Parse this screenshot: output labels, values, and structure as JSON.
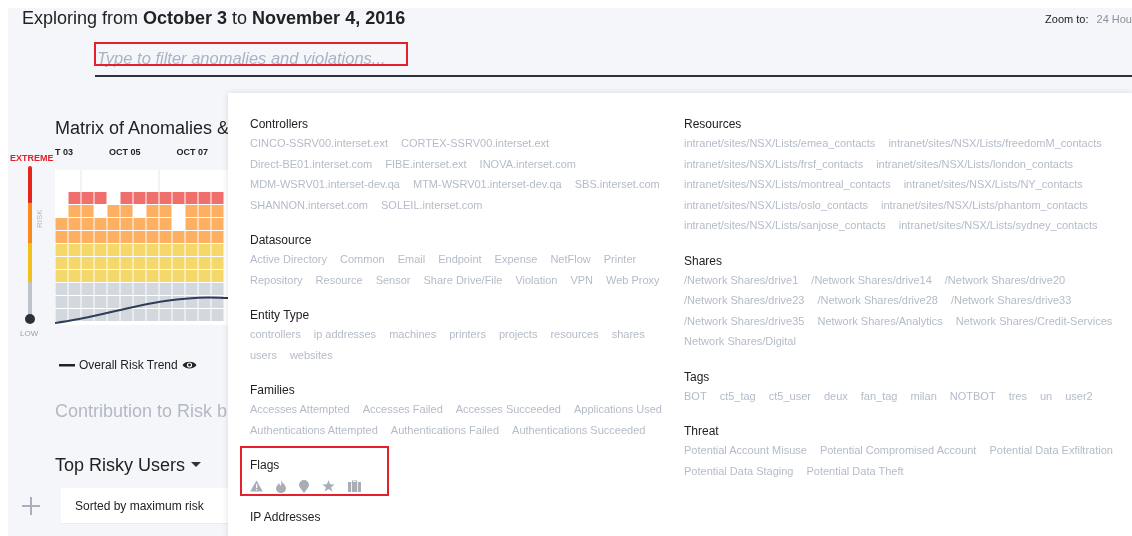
{
  "header": {
    "title": "Exploring from **October 3** to **November 4, 2016**",
    "zoom_label": "Zoom to:",
    "zoom_value": "24 Hou"
  },
  "filter": {
    "placeholder": "Type to filter anomalies and violations...",
    "highlighted": true
  },
  "matrix": {
    "title": "Matrix of Anomalies &",
    "x_labels": [
      "T 03",
      "OCT 05",
      "OCT 07"
    ],
    "scale_top": "EXTREME",
    "scale_axis": "RISK",
    "scale_bottom": "LOW",
    "legend": "Overall Risk Trend"
  },
  "contribution": {
    "title": "Contribution to Risk b"
  },
  "top_users": {
    "title": "Top Risky Users",
    "sort_label": "Sorted by maximum risk"
  },
  "dropdown": {
    "columns": [
      [
        {
          "kind": "text",
          "heading": "Controllers",
          "items": [
            "CINCO-SSRV00.interset.ext",
            "CORTEX-SSRV00.interset.ext",
            "Direct-BE01.interset.com",
            "FIBE.interset.ext",
            "INOVA.interset.com",
            "MDM-WSRV01.interset-dev.qa",
            "MTM-WSRV01.interset-dev.qa",
            "SBS.interset.com",
            "SHANNON.interset.com",
            "SOLEIL.interset.com"
          ]
        },
        {
          "kind": "text",
          "heading": "Datasource",
          "items": [
            "Active Directory",
            "Common",
            "Email",
            "Endpoint",
            "Expense",
            "NetFlow",
            "Printer",
            "Repository",
            "Resource",
            "Sensor",
            "Share Drive/File",
            "Violation",
            "VPN",
            "Web Proxy"
          ]
        },
        {
          "kind": "text",
          "heading": "Entity Type",
          "items": [
            "controllers",
            "ip addresses",
            "machines",
            "printers",
            "projects",
            "resources",
            "shares",
            "users",
            "websites"
          ]
        },
        {
          "kind": "text",
          "heading": "Families",
          "items": [
            "Accesses Attempted",
            "Accesses Failed",
            "Accesses Succeeded",
            "Applications Used",
            "Authentications Attempted",
            "Authentications Failed",
            "Authentications Succeeded"
          ]
        },
        {
          "kind": "flags",
          "heading": "Flags",
          "highlighted": true
        },
        {
          "kind": "text",
          "heading": "IP Addresses"
        }
      ],
      [
        {
          "kind": "text",
          "heading": "Resources",
          "items": [
            "intranet/sites/NSX/Lists/emea_contacts",
            "intranet/sites/NSX/Lists/freedomM_contacts",
            "intranet/sites/NSX/Lists/frsf_contacts",
            "intranet/sites/NSX/Lists/london_contacts",
            "intranet/sites/NSX/Lists/montreal_contacts",
            "intranet/sites/NSX/Lists/NY_contacts",
            "intranet/sites/NSX/Lists/oslo_contacts",
            "intranet/sites/NSX/Lists/phantom_contacts",
            "intranet/sites/NSX/Lists/sanjose_contacts",
            "intranet/sites/NSX/Lists/sydney_contacts"
          ]
        },
        {
          "kind": "text",
          "heading": "Shares",
          "items": [
            "/Network Shares/drive1",
            "/Network Shares/drive14",
            "/Network Shares/drive20",
            "/Network Shares/drive23",
            "/Network Shares/drive28",
            "/Network Shares/drive33",
            "/Network Shares/drive35",
            "Network Shares/Analytics",
            "Network Shares/Credit-Services",
            "Network Shares/Digital"
          ]
        },
        {
          "kind": "text",
          "heading": "Tags",
          "items": [
            "BOT",
            "ct5_tag",
            "ct5_user",
            "deux",
            "fan_tag",
            "milan",
            "NOTBOT",
            "tres",
            "un",
            "user2"
          ]
        },
        {
          "kind": "text",
          "heading": "Threat",
          "items": [
            "Potential Account Misuse",
            "Potential Compromised Account",
            "Potential Data Exfiltration",
            "Potential Data Staging",
            "Potential Data Theft"
          ]
        }
      ]
    ]
  }
}
